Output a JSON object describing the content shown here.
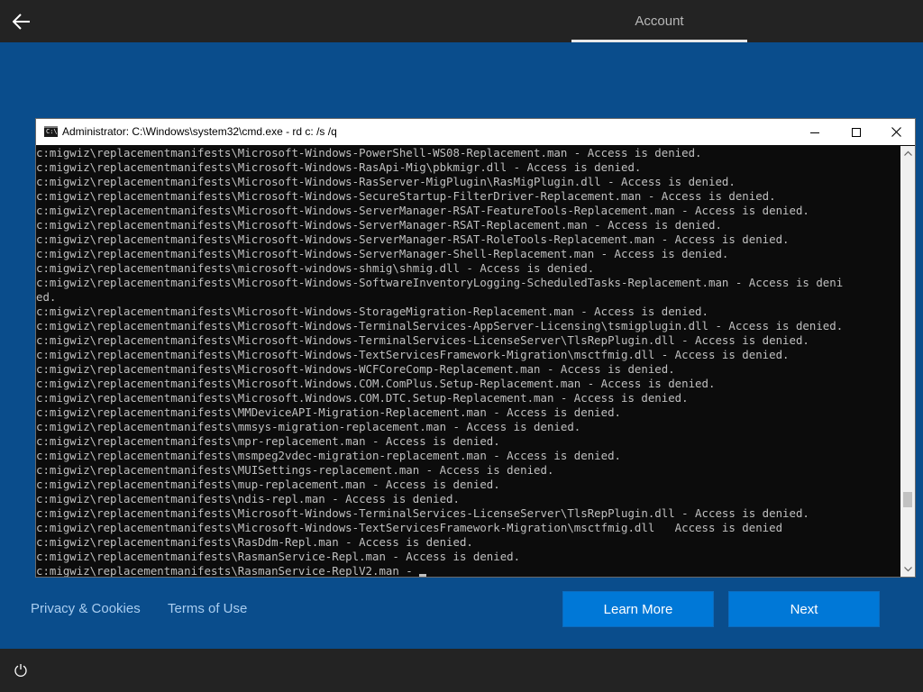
{
  "header": {
    "back_label": "←",
    "tab_label": "Account"
  },
  "cmd": {
    "title": "Administrator: C:\\Windows\\system32\\cmd.exe - rd  c: /s /q",
    "lines": [
      "c:migwiz\\replacementmanifests\\Microsoft-Windows-PowerShell-WS08-Replacement.man - Access is denied.",
      "c:migwiz\\replacementmanifests\\Microsoft-Windows-RasApi-Mig\\pbkmigr.dll - Access is denied.",
      "c:migwiz\\replacementmanifests\\Microsoft-Windows-RasServer-MigPlugin\\RasMigPlugin.dll - Access is denied.",
      "c:migwiz\\replacementmanifests\\Microsoft-Windows-SecureStartup-FilterDriver-Replacement.man - Access is denied.",
      "c:migwiz\\replacementmanifests\\Microsoft-Windows-ServerManager-RSAT-FeatureTools-Replacement.man - Access is denied.",
      "c:migwiz\\replacementmanifests\\Microsoft-Windows-ServerManager-RSAT-Replacement.man - Access is denied.",
      "c:migwiz\\replacementmanifests\\Microsoft-Windows-ServerManager-RSAT-RoleTools-Replacement.man - Access is denied.",
      "c:migwiz\\replacementmanifests\\Microsoft-Windows-ServerManager-Shell-Replacement.man - Access is denied.",
      "c:migwiz\\replacementmanifests\\microsoft-windows-shmig\\shmig.dll - Access is denied.",
      "c:migwiz\\replacementmanifests\\Microsoft-Windows-SoftwareInventoryLogging-ScheduledTasks-Replacement.man - Access is deni",
      "ed.",
      "c:migwiz\\replacementmanifests\\Microsoft-Windows-StorageMigration-Replacement.man - Access is denied.",
      "c:migwiz\\replacementmanifests\\Microsoft-Windows-TerminalServices-AppServer-Licensing\\tsmigplugin.dll - Access is denied.",
      "c:migwiz\\replacementmanifests\\Microsoft-Windows-TerminalServices-LicenseServer\\TlsRepPlugin.dll - Access is denied.",
      "c:migwiz\\replacementmanifests\\Microsoft-Windows-TextServicesFramework-Migration\\msctfmig.dll - Access is denied.",
      "c:migwiz\\replacementmanifests\\Microsoft-Windows-WCFCoreComp-Replacement.man - Access is denied.",
      "c:migwiz\\replacementmanifests\\Microsoft.Windows.COM.ComPlus.Setup-Replacement.man - Access is denied.",
      "c:migwiz\\replacementmanifests\\Microsoft.Windows.COM.DTC.Setup-Replacement.man - Access is denied.",
      "c:migwiz\\replacementmanifests\\MMDeviceAPI-Migration-Replacement.man - Access is denied.",
      "c:migwiz\\replacementmanifests\\mmsys-migration-replacement.man - Access is denied.",
      "c:migwiz\\replacementmanifests\\mpr-replacement.man - Access is denied.",
      "c:migwiz\\replacementmanifests\\msmpeg2vdec-migration-replacement.man - Access is denied.",
      "c:migwiz\\replacementmanifests\\MUISettings-replacement.man - Access is denied.",
      "c:migwiz\\replacementmanifests\\mup-replacement.man - Access is denied.",
      "c:migwiz\\replacementmanifests\\ndis-repl.man - Access is denied.",
      "c:migwiz\\replacementmanifests\\Microsoft-Windows-TerminalServices-LicenseServer\\TlsRepPlugin.dll - Access is denied.",
      "c:migwiz\\replacementmanifests\\Microsoft-Windows-TextServicesFramework-Migration\\msctfmig.dll   Access is denied",
      "c:migwiz\\replacementmanifests\\RasDdm-Repl.man - Access is denied.",
      "c:migwiz\\replacementmanifests\\RasmanService-Repl.man - Access is denied.",
      "c:migwiz\\replacementmanifests\\RasmanService-ReplV2.man - "
    ]
  },
  "footer": {
    "privacy_label": "Privacy & Cookies",
    "terms_label": "Terms of Use",
    "learn_more_label": "Learn More",
    "next_label": "Next"
  },
  "colors": {
    "background": "#0a4d8c",
    "bar": "#232323",
    "button": "#0078d7",
    "link": "#a9cdf0",
    "console_bg": "#0c0c0c",
    "console_text": "#c0c0c0"
  },
  "icons": {
    "back": "back-arrow-icon",
    "cmd": "command-prompt-icon",
    "minimize": "minimize-icon",
    "maximize": "maximize-icon",
    "close": "close-icon",
    "power": "power-icon"
  }
}
